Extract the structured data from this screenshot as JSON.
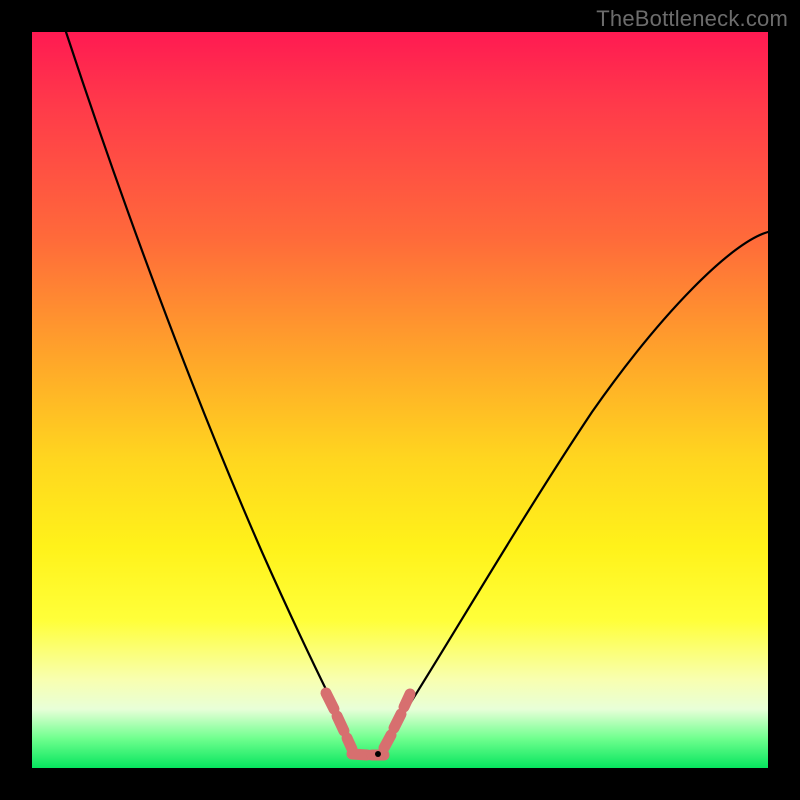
{
  "watermark": {
    "text": "TheBottleneck.com"
  },
  "colors": {
    "background": "#000000",
    "curve": "#000000",
    "highlight": "#d76f6f",
    "gradient_stops": [
      "#ff1a52",
      "#ff6a3a",
      "#ffd61f",
      "#ffff3a",
      "#6fff8e",
      "#06e55e"
    ]
  },
  "chart_data": {
    "type": "line",
    "title": "",
    "xlabel": "",
    "ylabel": "",
    "xlim": [
      0,
      100
    ],
    "ylim": [
      0,
      100
    ],
    "grid": false,
    "legend": false,
    "series": [
      {
        "name": "left-curve",
        "x": [
          5,
          10,
          15,
          20,
          25,
          30,
          35,
          40,
          45
        ],
        "values": [
          100,
          82,
          65,
          50,
          36,
          24,
          14,
          6,
          1
        ]
      },
      {
        "name": "right-curve",
        "x": [
          47,
          50,
          55,
          60,
          65,
          70,
          75,
          80,
          85,
          90,
          95,
          100
        ],
        "values": [
          1,
          3,
          9,
          16,
          24,
          32,
          40,
          48,
          55,
          62,
          68,
          72
        ]
      }
    ],
    "valley_highlight": {
      "x_range": [
        38,
        49
      ],
      "y_range": [
        0,
        8
      ]
    }
  }
}
